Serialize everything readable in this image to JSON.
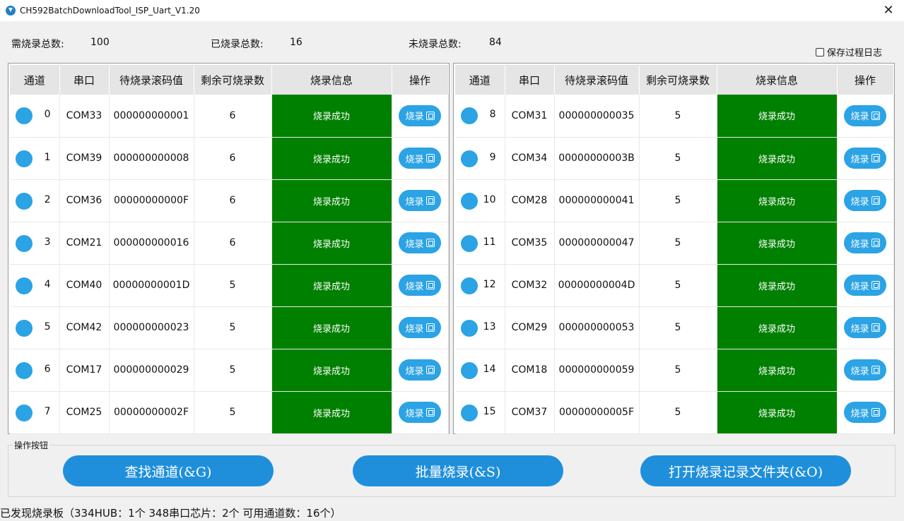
{
  "window": {
    "title": "CH592BatchDownloadTool_ISP_Uart_V1.20",
    "close": "✕"
  },
  "stats": {
    "total_label": "需烧录总数:",
    "total_value": "100",
    "done_label": "已烧录总数:",
    "done_value": "16",
    "remaining_label": "未烧录总数:",
    "remaining_value": "84"
  },
  "log_checkbox": {
    "label": "保存过程日志",
    "checked": false
  },
  "table": {
    "headers": [
      "通道",
      "串口",
      "待烧录滚码值",
      "剩余可烧录数",
      "烧录信息",
      "操作"
    ],
    "button_label": "烧录",
    "status_color": "#008000",
    "left_rows": [
      {
        "ch": "0",
        "port": "COM33",
        "code": "000000000001",
        "remain": "6",
        "info": "烧录成功"
      },
      {
        "ch": "1",
        "port": "COM39",
        "code": "000000000008",
        "remain": "6",
        "info": "烧录成功"
      },
      {
        "ch": "2",
        "port": "COM36",
        "code": "00000000000F",
        "remain": "6",
        "info": "烧录成功"
      },
      {
        "ch": "3",
        "port": "COM21",
        "code": "000000000016",
        "remain": "6",
        "info": "烧录成功"
      },
      {
        "ch": "4",
        "port": "COM40",
        "code": "00000000001D",
        "remain": "5",
        "info": "烧录成功"
      },
      {
        "ch": "5",
        "port": "COM42",
        "code": "000000000023",
        "remain": "5",
        "info": "烧录成功"
      },
      {
        "ch": "6",
        "port": "COM17",
        "code": "000000000029",
        "remain": "5",
        "info": "烧录成功"
      },
      {
        "ch": "7",
        "port": "COM25",
        "code": "00000000002F",
        "remain": "5",
        "info": "烧录成功"
      }
    ],
    "right_rows": [
      {
        "ch": "8",
        "port": "COM31",
        "code": "000000000035",
        "remain": "5",
        "info": "烧录成功"
      },
      {
        "ch": "9",
        "port": "COM34",
        "code": "00000000003B",
        "remain": "5",
        "info": "烧录成功"
      },
      {
        "ch": "10",
        "port": "COM28",
        "code": "000000000041",
        "remain": "5",
        "info": "烧录成功"
      },
      {
        "ch": "11",
        "port": "COM35",
        "code": "000000000047",
        "remain": "5",
        "info": "烧录成功"
      },
      {
        "ch": "12",
        "port": "COM32",
        "code": "00000000004D",
        "remain": "5",
        "info": "烧录成功"
      },
      {
        "ch": "13",
        "port": "COM29",
        "code": "000000000053",
        "remain": "5",
        "info": "烧录成功"
      },
      {
        "ch": "14",
        "port": "COM18",
        "code": "000000000059",
        "remain": "5",
        "info": "烧录成功"
      },
      {
        "ch": "15",
        "port": "COM37",
        "code": "00000000005F",
        "remain": "5",
        "info": "烧录成功"
      }
    ]
  },
  "actions": {
    "group_label": "操作按钮",
    "find_label": "查找通道(&G)",
    "batch_label": "批量烧录(&S)",
    "open_label": "打开烧录记录文件夹(&O)"
  },
  "status_bar": {
    "text": "已发现烧录板（334HUB：1个 348串口芯片：2个 可用通道数：16个）"
  }
}
